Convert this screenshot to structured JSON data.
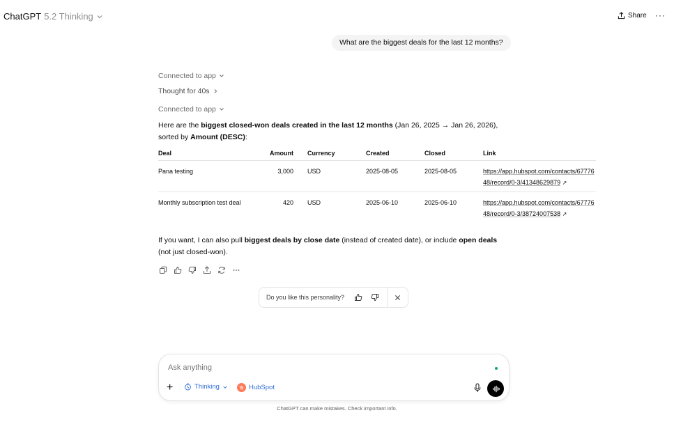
{
  "header": {
    "brand": "ChatGPT",
    "model_variant": "5.2 Thinking",
    "share_label": "Share",
    "more_label": "···"
  },
  "conversation": {
    "user_message": "What are the biggest deals for the last 12 months?",
    "connected_label_1": "Connected to app",
    "thought_label": "Thought for 40s",
    "connected_label_2": "Connected to app",
    "intro": {
      "t1": "Here are the ",
      "b1": "biggest closed-won deals created in the last 12 months",
      "t2": " (Jan 26, 2025 → Jan 26, 2026), sorted by ",
      "b2": "Amount (DESC)",
      "t3": ":"
    },
    "table": {
      "headers": [
        "Deal",
        "Amount",
        "Currency",
        "Created",
        "Closed",
        "Link"
      ],
      "rows": [
        {
          "deal": "Pana testing",
          "amount": "3,000",
          "currency": "USD",
          "created": "2025-08-05",
          "closed": "2025-08-05",
          "link": "https://app.hubspot.com/contacts/6777648/record/0-3/41348629879"
        },
        {
          "deal": "Monthly subscription test deal",
          "amount": "420",
          "currency": "USD",
          "created": "2025-06-10",
          "closed": "2025-06-10",
          "link": "https://app.hubspot.com/contacts/6777648/record/0-3/38724007538"
        }
      ],
      "external_glyph": "↗"
    },
    "followup": {
      "t1": "If you want, I can also pull ",
      "b1": "biggest deals by close date",
      "t2": " (instead of created date), or include ",
      "b2": "open deals",
      "t3": " (not just closed-won)."
    },
    "actions": [
      "copy-icon",
      "thumbs-up-icon",
      "thumbs-down-icon",
      "share-icon",
      "regenerate-icon",
      "more-icon"
    ]
  },
  "feedback": {
    "question": "Do you like this personality?"
  },
  "composer": {
    "placeholder": "Ask anything",
    "thinking_label": "Thinking",
    "hubspot_label": "HubSpot"
  },
  "footer": {
    "disclaimer": "ChatGPT can make mistakes. Check important info."
  },
  "colors": {
    "accent_blue": "#2f6fd6",
    "hubspot_orange": "#ff7a59",
    "status_green": "#10a37f"
  }
}
